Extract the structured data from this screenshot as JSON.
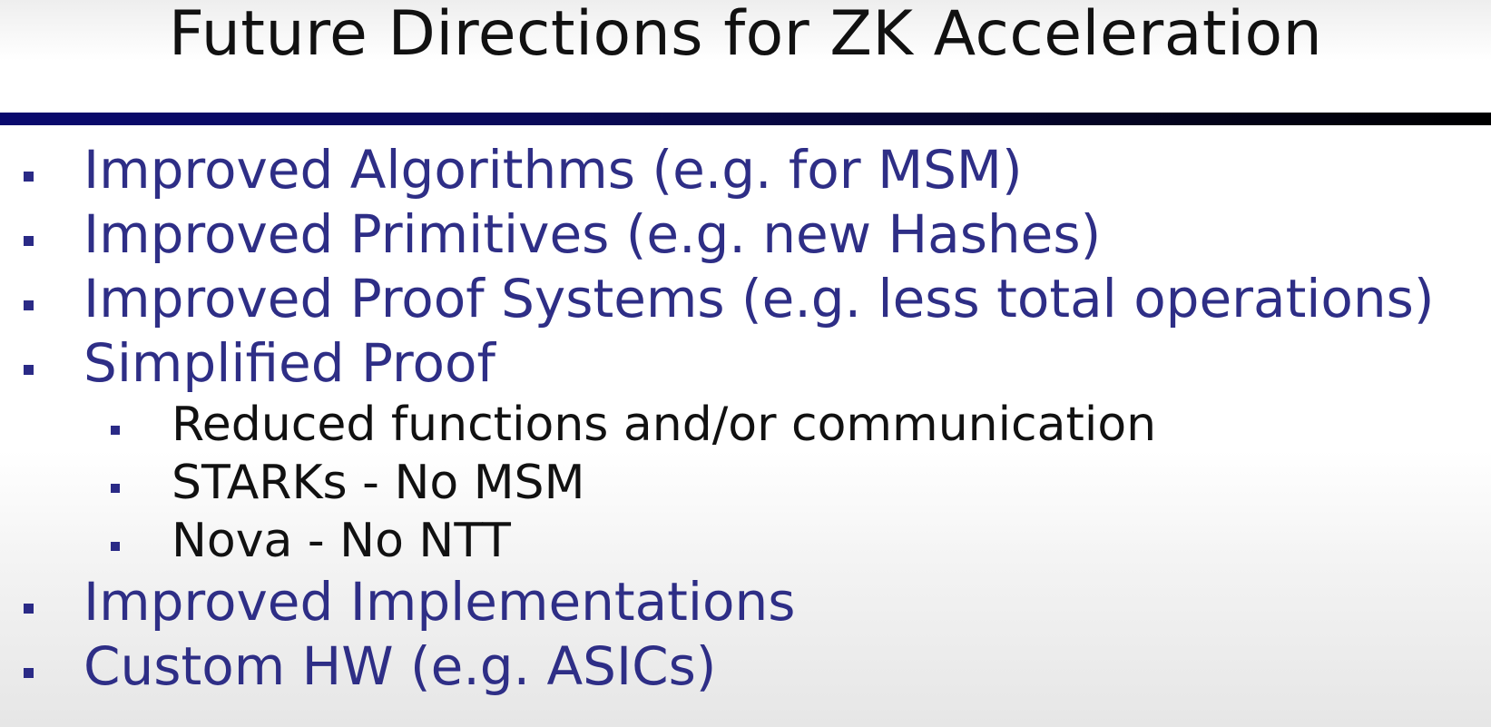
{
  "slide": {
    "title": "Future Directions for ZK Acceleration",
    "colors": {
      "bullet_text": "#2e2e86",
      "sub_bullet_text": "#111111",
      "marker": "#2a2a86",
      "rule_start": "#0a0a6e",
      "rule_end": "#000000"
    },
    "bullets": [
      "Improved Algorithms (e.g. for MSM)",
      "Improved Primitives (e.g. new Hashes)",
      "Improved Proof Systems (e.g. less total operations)",
      "Simplified Proof",
      "Improved Implementations",
      "Custom HW (e.g. ASICs)"
    ],
    "sub_bullets": [
      "Reduced functions and/or communication",
      "STARKs - No MSM",
      "Nova - No NTT"
    ]
  }
}
